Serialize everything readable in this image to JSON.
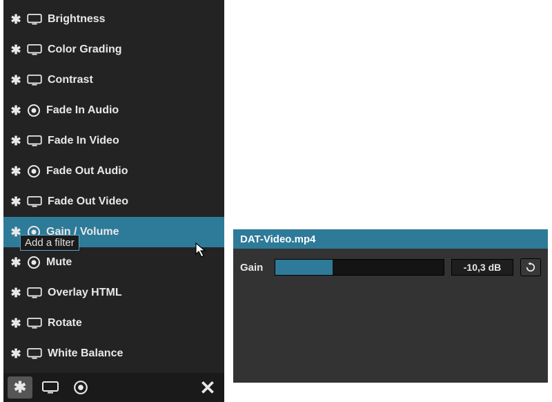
{
  "filters": {
    "items": [
      {
        "label": "Brightness",
        "icon": "screen"
      },
      {
        "label": "Color Grading",
        "icon": "screen"
      },
      {
        "label": "Contrast",
        "icon": "screen"
      },
      {
        "label": "Fade In Audio",
        "icon": "audio"
      },
      {
        "label": "Fade In Video",
        "icon": "screen"
      },
      {
        "label": "Fade Out Audio",
        "icon": "audio"
      },
      {
        "label": "Fade Out Video",
        "icon": "screen"
      },
      {
        "label": "Gain / Volume",
        "icon": "audio",
        "selected": true
      },
      {
        "label": "Mute",
        "icon": "audio"
      },
      {
        "label": "Overlay HTML",
        "icon": "screen"
      },
      {
        "label": "Rotate",
        "icon": "screen"
      },
      {
        "label": "White Balance",
        "icon": "screen"
      }
    ],
    "tooltip": "Add a filter"
  },
  "toolbar": {
    "add": "add-filter",
    "video_category": "video-filters",
    "audio_category": "audio-filters",
    "close": "close"
  },
  "properties": {
    "file": "DAT-Video.mp4",
    "gain_label": "Gain",
    "gain_value": "-10,3 dB",
    "gain_fill_percent": 34
  },
  "colors": {
    "accent": "#2e7a99",
    "panel_bg": "#232323",
    "panel2_bg": "#333333"
  }
}
